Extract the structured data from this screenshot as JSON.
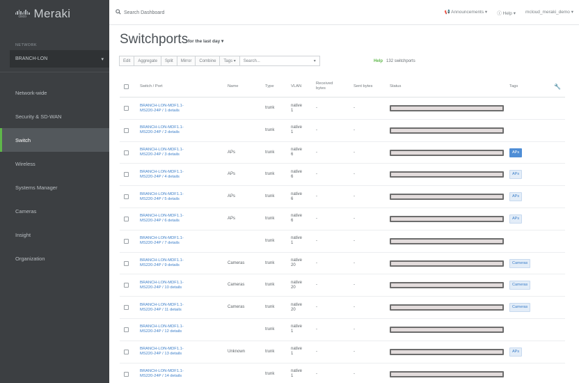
{
  "brand": {
    "logo_text": "cisco",
    "name": "Meraki"
  },
  "sidebar": {
    "network_label": "NETWORK",
    "network_value": "BRANCH-LON",
    "items": [
      {
        "label": "Network-wide"
      },
      {
        "label": "Security & SD-WAN"
      },
      {
        "label": "Switch"
      },
      {
        "label": "Wireless"
      },
      {
        "label": "Systems Manager"
      },
      {
        "label": "Cameras"
      },
      {
        "label": "Insight"
      },
      {
        "label": "Organization"
      }
    ]
  },
  "topbar": {
    "search_placeholder": "Search Dashboard",
    "announcements": "Announcements",
    "help": "Help",
    "account": "mcloud_meraki_demo"
  },
  "page": {
    "title": "Switchports",
    "period": "for the last day"
  },
  "toolbar": {
    "buttons": [
      "Edit",
      "Aggregate",
      "Split",
      "Mirror",
      "Combine",
      "Tags"
    ],
    "search_placeholder": "Search...",
    "help_link": "Help",
    "count": "132 switchports"
  },
  "table": {
    "headers": {
      "switch_port": "Switch / Port",
      "name": "Name",
      "type": "Type",
      "vlan": "VLAN",
      "received": "Received bytes",
      "sent": "Sent bytes",
      "status": "Status",
      "tags": "Tags"
    },
    "rows": [
      {
        "line1": "BRANCH-LON-MDF1.1-",
        "line2": "MS220-24P / 1 details",
        "name": "",
        "type": "trunk",
        "vlan1": "native",
        "vlan2": "1",
        "received": "-",
        "sent": "-",
        "tag": ""
      },
      {
        "line1": "BRANCH-LON-MDF1.1-",
        "line2": "MS220-24P / 2 details",
        "name": "",
        "type": "trunk",
        "vlan1": "native",
        "vlan2": "1",
        "received": "-",
        "sent": "-",
        "tag": ""
      },
      {
        "line1": "BRANCH-LON-MDF1.1-",
        "line2": "MS220-24P / 3 details",
        "name": "APs",
        "type": "trunk",
        "vlan1": "native",
        "vlan2": "6",
        "received": "-",
        "sent": "-",
        "tag": "APs",
        "tag_solid": true
      },
      {
        "line1": "BRANCH-LON-MDF1.1-",
        "line2": "MS220-24P / 4 details",
        "name": "APs",
        "type": "trunk",
        "vlan1": "native",
        "vlan2": "6",
        "received": "-",
        "sent": "-",
        "tag": "APs"
      },
      {
        "line1": "BRANCH-LON-MDF1.1-",
        "line2": "MS220-24P / 5 details",
        "name": "APs",
        "type": "trunk",
        "vlan1": "native",
        "vlan2": "6",
        "received": "-",
        "sent": "-",
        "tag": "APs"
      },
      {
        "line1": "BRANCH-LON-MDF1.1-",
        "line2": "MS220-24P / 6 details",
        "name": "APs",
        "type": "trunk",
        "vlan1": "native",
        "vlan2": "6",
        "received": "-",
        "sent": "-",
        "tag": "APs"
      },
      {
        "line1": "BRANCH-LON-MDF1.1-",
        "line2": "MS220-24P / 7 details",
        "name": "",
        "type": "trunk",
        "vlan1": "native",
        "vlan2": "1",
        "received": "-",
        "sent": "-",
        "tag": ""
      },
      {
        "line1": "BRANCH-LON-MDF1.1-",
        "line2": "MS220-24P / 9 details",
        "name": "Cameras",
        "type": "trunk",
        "vlan1": "native",
        "vlan2": "20",
        "received": "-",
        "sent": "-",
        "tag": "Cameras"
      },
      {
        "line1": "BRANCH-LON-MDF1.1-",
        "line2": "MS220-24P / 10 details",
        "name": "Cameras",
        "type": "trunk",
        "vlan1": "native",
        "vlan2": "20",
        "received": "-",
        "sent": "-",
        "tag": "Cameras"
      },
      {
        "line1": "BRANCH-LON-MDF1.1-",
        "line2": "MS220-24P / 11 details",
        "name": "Cameras",
        "type": "trunk",
        "vlan1": "native",
        "vlan2": "20",
        "received": "-",
        "sent": "-",
        "tag": "Cameras"
      },
      {
        "line1": "BRANCH-LON-MDF1.1-",
        "line2": "MS220-24P / 12 details",
        "name": "",
        "type": "trunk",
        "vlan1": "native",
        "vlan2": "1",
        "received": "-",
        "sent": "-",
        "tag": ""
      },
      {
        "line1": "BRANCH-LON-MDF1.1-",
        "line2": "MS220-24P / 13 details",
        "name": "Unknown",
        "type": "trunk",
        "vlan1": "native",
        "vlan2": "1",
        "received": "-",
        "sent": "-",
        "tag": "APs"
      },
      {
        "line1": "BRANCH-LON-MDF1.1-",
        "line2": "MS220-24P / 14 details",
        "name": "",
        "type": "trunk",
        "vlan1": "native",
        "vlan2": "1",
        "received": "-",
        "sent": "-",
        "tag": ""
      }
    ]
  },
  "colors": {
    "sidebar_bg": "#3c3f42",
    "accent_green": "#5fb74a",
    "link_blue": "#3d7fc9"
  }
}
